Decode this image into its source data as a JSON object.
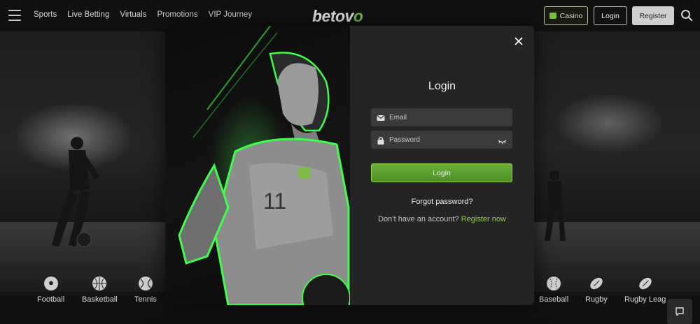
{
  "nav": {
    "items": [
      {
        "label": "Sports"
      },
      {
        "label": "Live Betting"
      },
      {
        "label": "Virtuals"
      },
      {
        "label": "Promotions"
      },
      {
        "label": "VIP Journey"
      }
    ]
  },
  "logo": {
    "text_main": "betov",
    "text_accent": "o"
  },
  "header": {
    "casino_label": "Casino",
    "login_label": "Login",
    "register_label": "Register"
  },
  "sports": [
    {
      "label": "Football",
      "icon": "football-icon"
    },
    {
      "label": "Basketball",
      "icon": "basketball-icon"
    },
    {
      "label": "Tennis",
      "icon": "tennis-icon"
    },
    {
      "label": "Baseball",
      "icon": "baseball-icon"
    },
    {
      "label": "Rugby",
      "icon": "rugby-icon"
    },
    {
      "label": "Rugby Leag",
      "icon": "rugby-league-icon"
    }
  ],
  "modal": {
    "title": "Login",
    "email_placeholder": "Email",
    "password_placeholder": "Password",
    "submit_label": "Login",
    "forgot_label": "Forgot password?",
    "signup_prompt": "Don’t have an account?",
    "signup_link": "Register now"
  },
  "colors": {
    "accent": "#7bc043",
    "button_green": "#5aa030",
    "background": "#0d0d0d",
    "modal_panel": "#242424"
  }
}
